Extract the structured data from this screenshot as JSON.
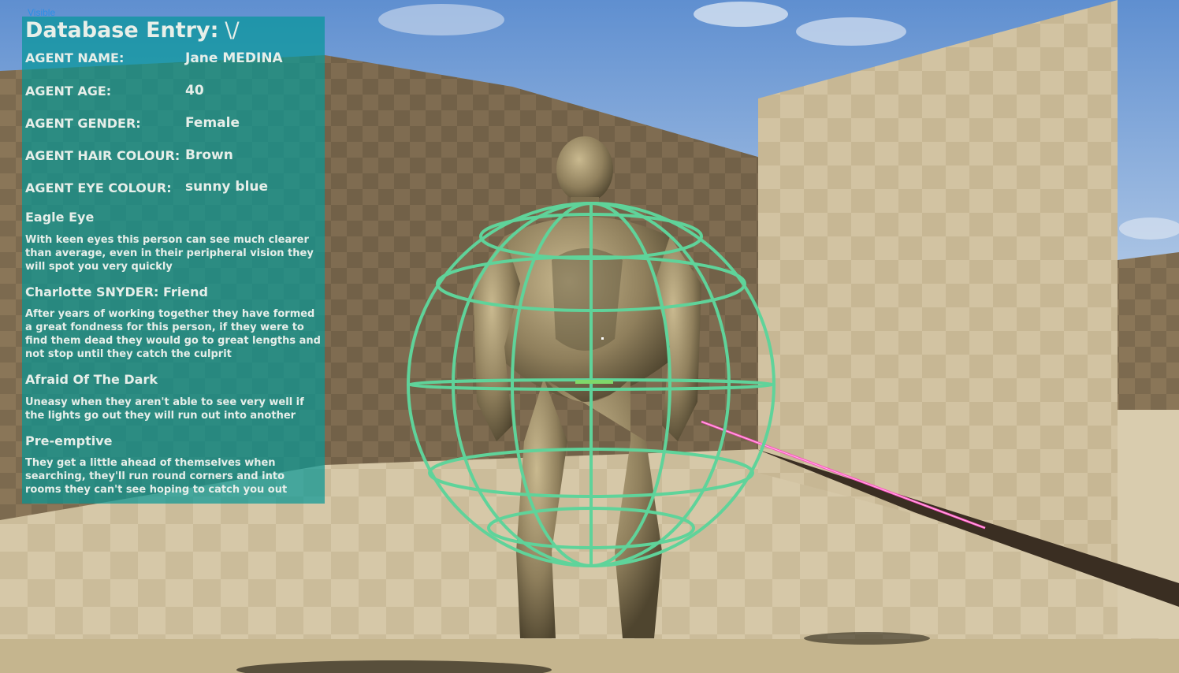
{
  "overlay": {
    "visibility_label": "Visible"
  },
  "entry": {
    "title": "Database Entry:",
    "title_glyph": "\\/",
    "fields": [
      {
        "label": "AGENT NAME:",
        "value": "Jane MEDINA"
      },
      {
        "label": "AGENT AGE:",
        "value": "40"
      },
      {
        "label": "AGENT GENDER:",
        "value": "Female"
      },
      {
        "label": "AGENT HAIR COLOUR:",
        "value": "Brown"
      },
      {
        "label": "AGENT EYE COLOUR:",
        "value": "sunny blue"
      }
    ],
    "traits": [
      {
        "name": "Eagle Eye",
        "description": "With keen eyes this person can see much clearer than average, even in their peripheral vision they will spot you very quickly"
      },
      {
        "name": "Charlotte SNYDER:  Friend",
        "description": "After years of working together they have formed a great fondness for this person, if they were to find them dead they would go to great lengths and not stop until they catch the culprit"
      },
      {
        "name": "Afraid Of The Dark",
        "description": "Uneasy when they aren't able to see very well if the lights go out they will run out  into another"
      },
      {
        "name": "Pre-emptive",
        "description": "They get a little ahead of themselves when searching, they'll run round corners and into rooms they can't see hoping to catch you out"
      }
    ]
  },
  "colors": {
    "panel_bg": "#1a9a9a",
    "wireframe": "#5fd39a",
    "laser": "#ff4fc0"
  }
}
